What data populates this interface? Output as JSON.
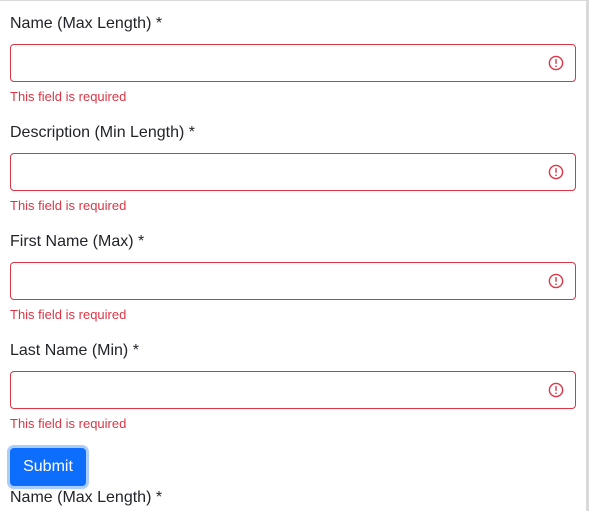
{
  "colors": {
    "error": "#dc3545",
    "primary": "#0d6efd",
    "text": "#212529"
  },
  "form": {
    "fields": [
      {
        "label": "Name (Max Length) *",
        "value": "",
        "error": "This field is required",
        "icon": "exclamation-circle-icon"
      },
      {
        "label": "Description (Min Length) *",
        "value": "",
        "error": "This field is required",
        "icon": "exclamation-circle-icon"
      },
      {
        "label": "First Name (Max) *",
        "value": "",
        "error": "This field is required",
        "icon": "exclamation-circle-icon"
      },
      {
        "label": "Last Name (Min) *",
        "value": "",
        "error": "This field is required",
        "icon": "exclamation-circle-icon"
      }
    ],
    "submit_label": "Submit",
    "next_form_label": "Name (Max Length) *"
  }
}
